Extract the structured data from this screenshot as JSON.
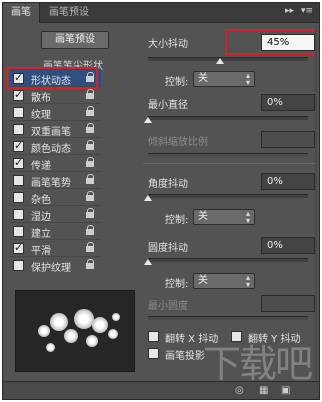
{
  "tabs": [
    {
      "label": "画笔"
    },
    {
      "label": "画笔预设"
    }
  ],
  "panel_controls": {
    "expand": "▸▸",
    "menu": "▾≡"
  },
  "preset_button": {
    "label": "画笔预设"
  },
  "tip_shape_title": "画笔笔尖形状",
  "options": [
    {
      "label": "形状动态",
      "checked": true
    },
    {
      "label": "散布",
      "checked": true
    },
    {
      "label": "纹理",
      "checked": false
    },
    {
      "label": "双重画笔",
      "checked": false
    },
    {
      "label": "颜色动态",
      "checked": true
    },
    {
      "label": "传递",
      "checked": true
    },
    {
      "label": "画笔笔势",
      "checked": false
    },
    {
      "label": "杂色",
      "checked": false
    },
    {
      "label": "湿边",
      "checked": false
    },
    {
      "label": "建立",
      "checked": false
    },
    {
      "label": "平滑",
      "checked": true
    },
    {
      "label": "保护纹理",
      "checked": false
    }
  ],
  "size_jitter": {
    "label": "大小抖动",
    "value": "45%",
    "level": 0.45
  },
  "size_control": {
    "label": "控制:",
    "value": "关"
  },
  "min_diameter": {
    "label": "最小直径",
    "value": "0%",
    "level": 0
  },
  "tilt_scale": {
    "label": "倾斜缩放比例"
  },
  "angle_jitter": {
    "label": "角度抖动",
    "value": "0%",
    "level": 0
  },
  "angle_control": {
    "label": "控制:",
    "value": "关"
  },
  "roundness_jitter": {
    "label": "圆度抖动",
    "value": "0%",
    "level": 0
  },
  "roundness_control": {
    "label": "控制:",
    "value": "关"
  },
  "min_roundness": {
    "label": "最小圆度"
  },
  "flip_x": {
    "label": "翻转 X 抖动",
    "checked": false
  },
  "flip_y": {
    "label": "翻转 Y 抖动",
    "checked": false
  },
  "brush_projection": {
    "label": "画笔投影",
    "checked": false
  },
  "watermark": "下载吧",
  "colors": {
    "highlight": "#d8202a",
    "panel": "#535353"
  }
}
